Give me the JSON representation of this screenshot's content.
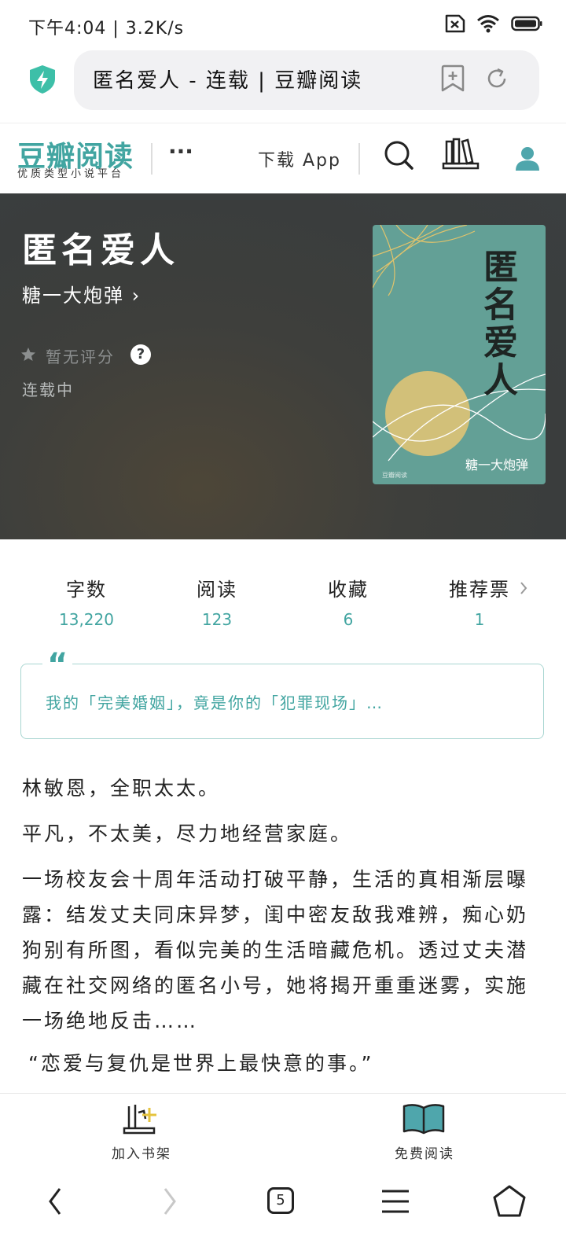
{
  "status_bar": {
    "text": "下午4:04 | 3.2K/s"
  },
  "browser": {
    "url_text": "匿名爱人 - 连载 | 豆瓣阅读",
    "tab_count": "5"
  },
  "site": {
    "logo": "豆瓣阅读",
    "tagline": "优质类型小说平台",
    "more": "···",
    "download": "下载 App"
  },
  "book": {
    "title": "匿名爱人",
    "author": "糖一大炮弹 ›",
    "rating": "暂无评分",
    "rating_help": "?",
    "status": "连载中",
    "cover_title": "匿名爱人",
    "cover_author": "糖一大炮弹",
    "cover_publisher": "豆瓣阅读"
  },
  "stats": [
    {
      "label": "字数",
      "value": "13,220"
    },
    {
      "label": "阅读",
      "value": "123"
    },
    {
      "label": "收藏",
      "value": "6"
    },
    {
      "label": "推荐票",
      "value": "1"
    }
  ],
  "quote": "我的「完美婚姻」，竟是你的「犯罪现场」…",
  "description": [
    "林敏恩，全职太太。",
    "平凡，不太美，尽力地经营家庭。",
    "一场校友会十周年活动打破平静，生活的真相渐层曝露：结发丈夫同床异梦，闺中密友敌我难辨，痴心奶狗别有所图，看似完美的生活暗藏危机。透过丈夫潜藏在社交网络的匿名小号，她将揭开重重迷雾，实施一场绝地反击……",
    "“恋爱与复仇是世界上最快意的事。”"
  ],
  "actions": {
    "add_shelf": "加入书架",
    "read_free": "免费阅读"
  },
  "colors": {
    "accent": "#42a5a1",
    "hero_bg": "#3b3f40",
    "cover_bg": "#63a096"
  }
}
